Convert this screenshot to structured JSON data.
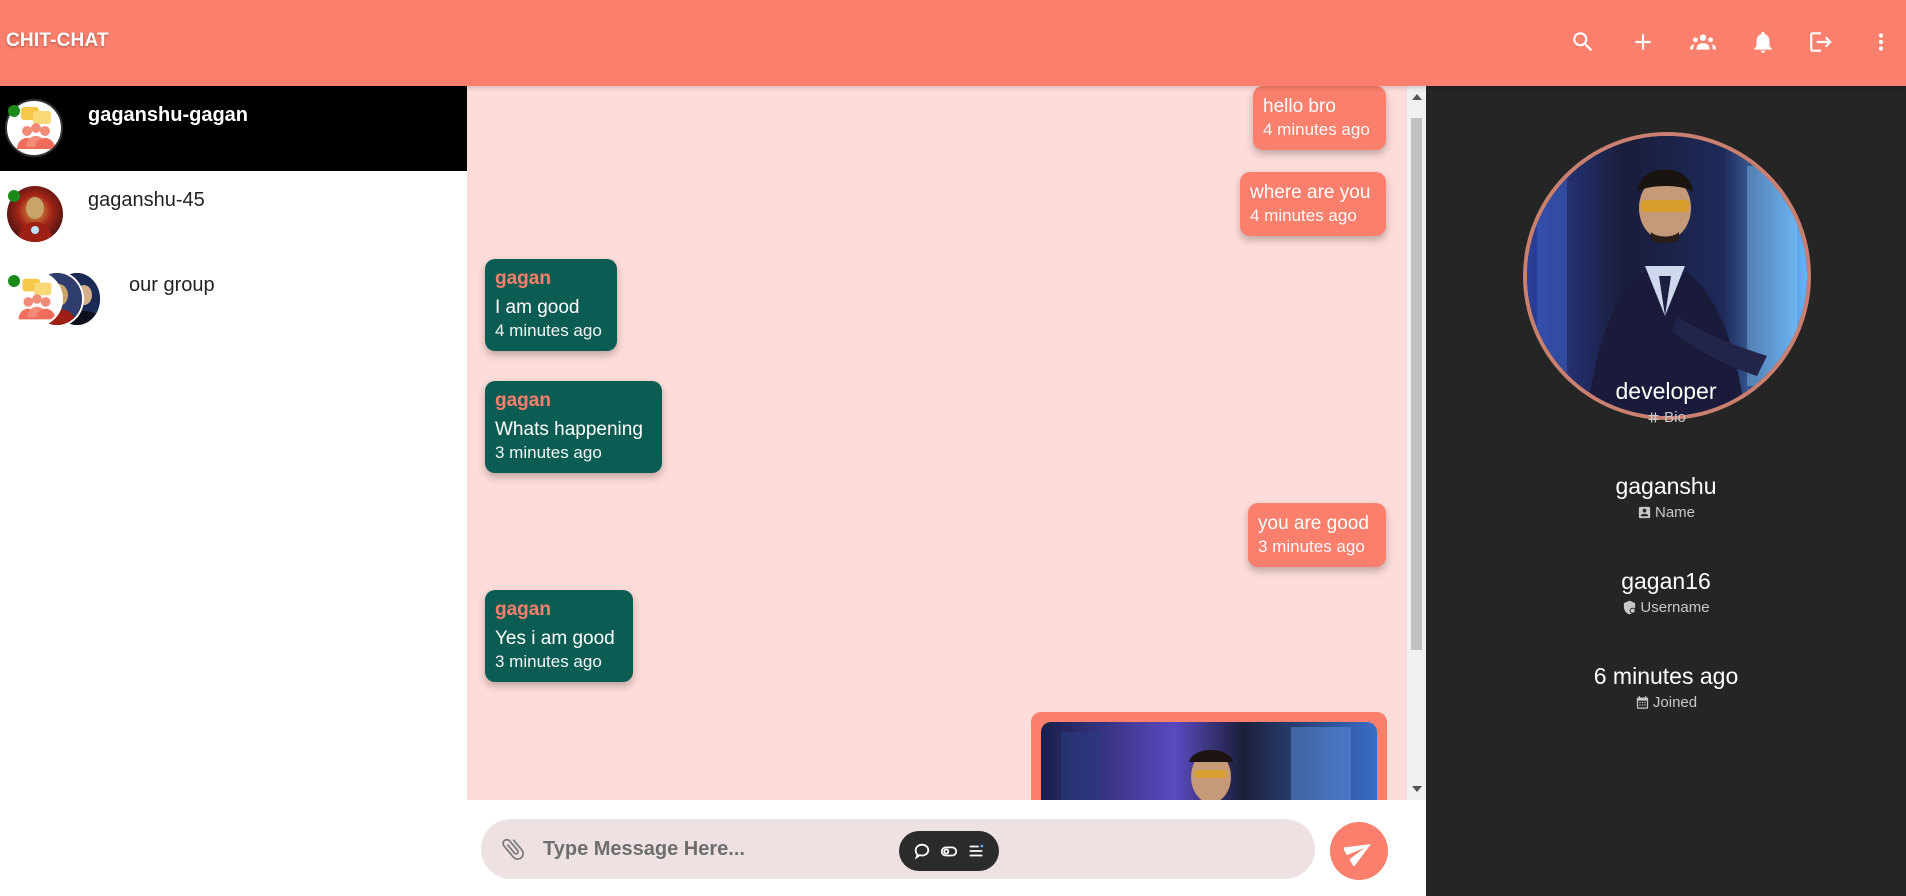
{
  "app": {
    "title": "CHIT-CHAT"
  },
  "colors": {
    "accent": "#fa7f6c",
    "incoming": "#0b5c52",
    "chat_bg": "#fddcd9",
    "panel_bg": "#252525"
  },
  "toolbar": {
    "icons": [
      "search-icon",
      "add-icon",
      "groups-icon",
      "notifications-icon",
      "logout-icon",
      "more-vert-icon"
    ]
  },
  "sidebar": {
    "conversations": [
      {
        "name": "gaganshu-gagan",
        "active": true,
        "online": true
      },
      {
        "name": "gaganshu-45",
        "active": false,
        "online": true
      },
      {
        "name": "our group",
        "active": false,
        "online": true
      }
    ]
  },
  "messages": [
    {
      "direction": "out",
      "text": "hello bro",
      "time": "4 minutes ago"
    },
    {
      "direction": "out",
      "text": "where are you",
      "time": "4 minutes ago"
    },
    {
      "direction": "in",
      "sender": "gagan",
      "text": "I am good",
      "time": "4 minutes ago"
    },
    {
      "direction": "in",
      "sender": "gagan",
      "text": "Whats happening",
      "time": "3 minutes ago"
    },
    {
      "direction": "out",
      "text": "you are good",
      "time": "3 minutes ago"
    },
    {
      "direction": "in",
      "sender": "gagan",
      "text": "Yes i am good",
      "time": "3 minutes ago"
    }
  ],
  "composer": {
    "placeholder": "Type Message Here..."
  },
  "profile": {
    "bio": {
      "value": "developer",
      "label": "Bio"
    },
    "name": {
      "value": "gaganshu",
      "label": "Name"
    },
    "username": {
      "value": "gagan16",
      "label": "Username"
    },
    "joined": {
      "value": "6 minutes ago",
      "label": "Joined"
    }
  }
}
